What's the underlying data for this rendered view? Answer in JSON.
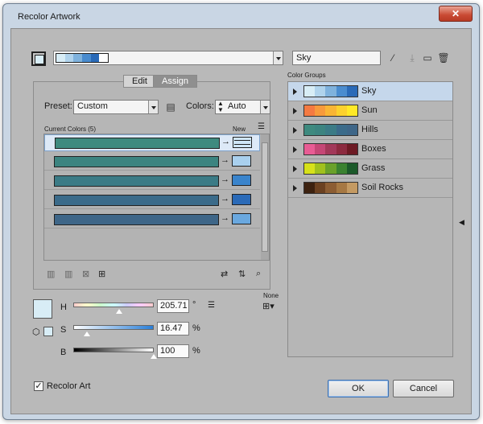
{
  "window": {
    "title": "Recolor Artwork",
    "close_label": "✕"
  },
  "top": {
    "harmony_colors": [
      "#d8edf6",
      "#b0d3ec",
      "#7fb2dd",
      "#4a8ccf",
      "#2a6ab8",
      "#ffffff"
    ],
    "group_name": "Sky"
  },
  "tabs": {
    "edit": "Edit",
    "assign": "Assign"
  },
  "preset": {
    "label": "Preset:",
    "value": "Custom"
  },
  "colors": {
    "label": "Colors:",
    "value": "Auto"
  },
  "current_colors": {
    "header": "Current Colors (5)",
    "new_header": "New",
    "rows": [
      {
        "current": "#3e8a7f",
        "new": "#cfe6f7",
        "selected": true
      },
      {
        "current": "#3c8480",
        "new": "#a9d0ee",
        "selected": false
      },
      {
        "current": "#3b7b86",
        "new": "#3a84cc",
        "selected": false
      },
      {
        "current": "#3b6b8a",
        "new": "#2a6ab8",
        "selected": false
      },
      {
        "current": "#3e6688",
        "new": "#6aa8df",
        "selected": false
      }
    ]
  },
  "color_groups": {
    "title": "Color Groups",
    "groups": [
      {
        "name": "Sky",
        "colors": [
          "#d8edf6",
          "#b0d3ec",
          "#7fb2dd",
          "#4a8ccf",
          "#2a6ab8"
        ],
        "selected": true
      },
      {
        "name": "Sun",
        "colors": [
          "#f47a42",
          "#f79a3c",
          "#f9b535",
          "#fcd12e",
          "#ffe927"
        ],
        "selected": false
      },
      {
        "name": "Hills",
        "colors": [
          "#3e8a7f",
          "#3c8480",
          "#3b7b86",
          "#3b6b8a",
          "#3e6688"
        ],
        "selected": false
      },
      {
        "name": "Boxes",
        "colors": [
          "#e85c94",
          "#c54776",
          "#a23859",
          "#8c2a3f",
          "#6d1a24"
        ],
        "selected": false
      },
      {
        "name": "Grass",
        "colors": [
          "#d7e11a",
          "#a1c11e",
          "#6aa12a",
          "#3b8230",
          "#1c5a2a"
        ],
        "selected": false
      },
      {
        "name": "Soil Rocks",
        "colors": [
          "#3d2210",
          "#6b4121",
          "#8c5d33",
          "#a67843",
          "#c49a62"
        ],
        "selected": false
      }
    ]
  },
  "hsb": {
    "h_label": "H",
    "h_value": "205.71",
    "h_unit": "°",
    "s_label": "S",
    "s_value": "16.47",
    "s_unit": "%",
    "b_label": "B",
    "b_value": "100",
    "b_unit": "%",
    "h_level": 0.571,
    "s_level": 0.165,
    "b_level": 1.0,
    "swatch_color": "#d8edf6"
  },
  "none_label": "None",
  "recolor_art": {
    "label": "Recolor Art",
    "checked": true
  },
  "buttons": {
    "ok": "OK",
    "cancel": "Cancel"
  }
}
